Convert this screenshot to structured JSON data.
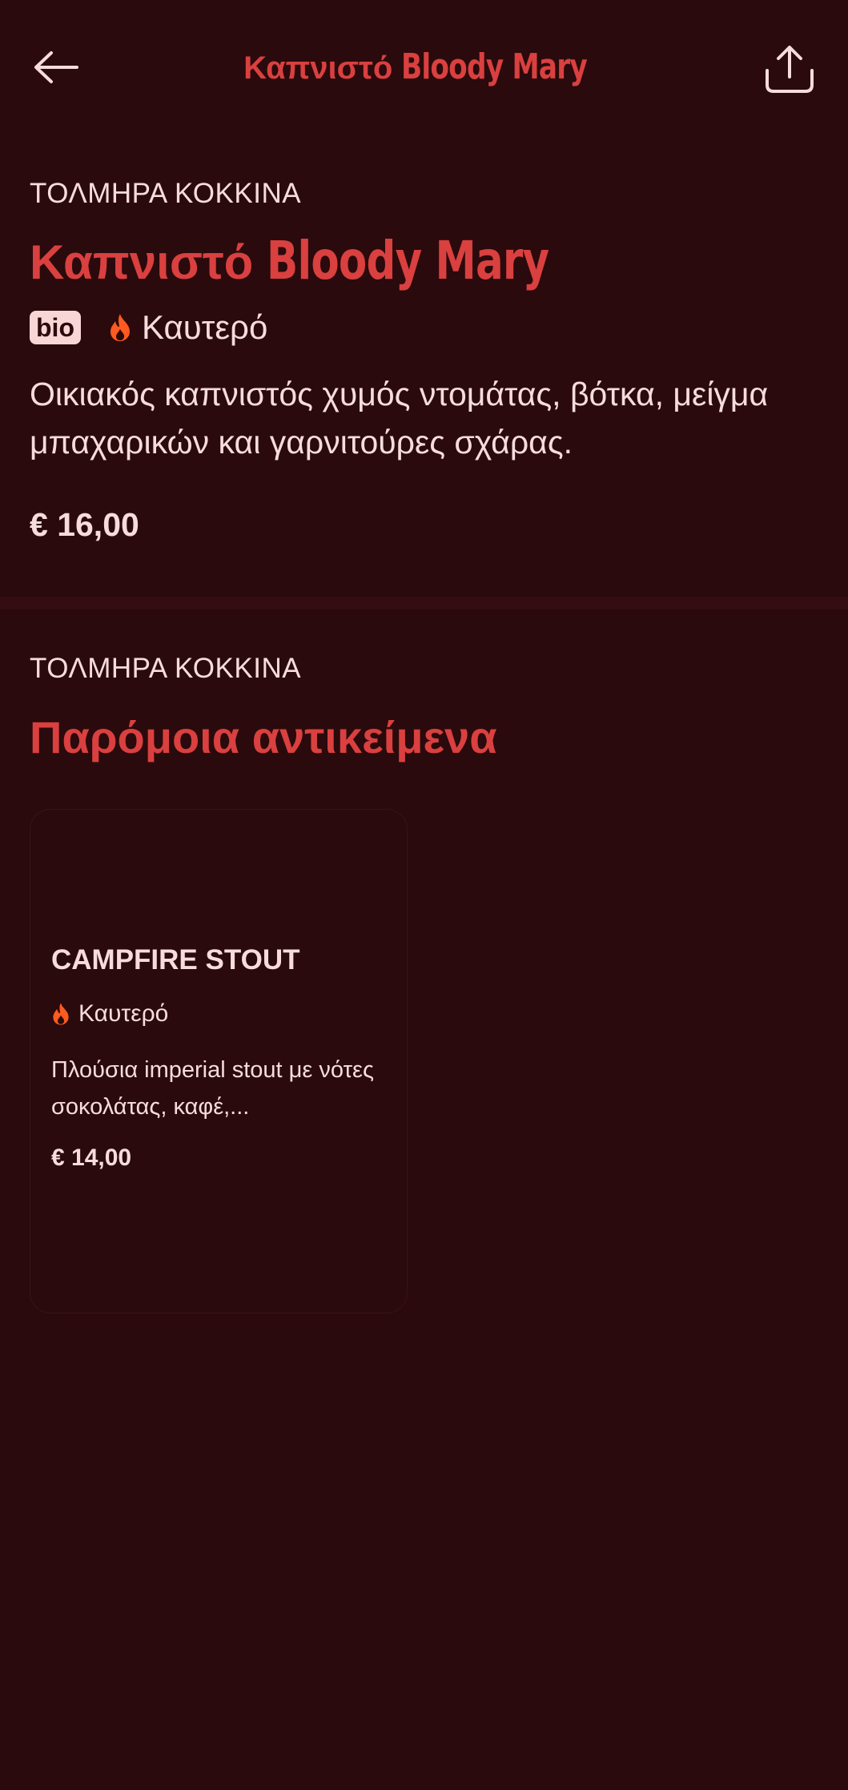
{
  "header": {
    "title_prefix": "Καπνιστό",
    "title_accent": "Bloody Mary"
  },
  "product": {
    "category": "ΤΟΛΜΗΡΑ ΚΟΚΚΙΝΑ",
    "title_prefix": "Καπνιστό",
    "title_accent": "Bloody Mary",
    "badge": "bio",
    "spicy_label": "Καυτερό",
    "description": "Οικιακός καπνιστός χυμός ντομάτας, βότκα, μείγμα μπαχαρικών και γαρνιτούρες σχάρας.",
    "price": "€ 16,00"
  },
  "similar": {
    "category": "ΤΟΛΜΗΡΑ ΚΟΚΚΙΝΑ",
    "title": "Παρόμοια αντικείμενα",
    "items": [
      {
        "name": "CAMPFIRE STOUT",
        "spicy_label": "Καυτερό",
        "description": "Πλούσια imperial stout με νότες σοκολάτας, καφέ,...",
        "price": "€ 14,00"
      }
    ]
  },
  "colors": {
    "background": "#2a0a0c",
    "accent": "#d9403f",
    "text": "#f6dcdc",
    "flame": "#ff5a1f"
  },
  "icons": {
    "back": "arrow-left-icon",
    "share": "share-icon",
    "spicy": "flame-icon"
  }
}
